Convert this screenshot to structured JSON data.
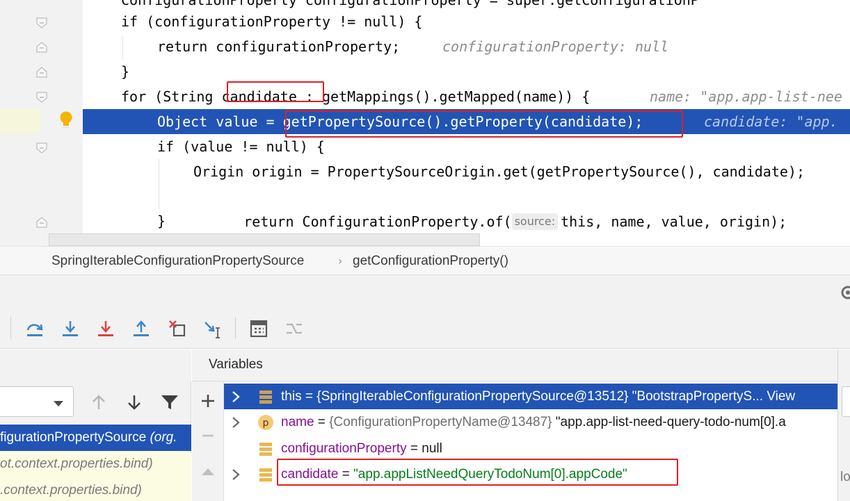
{
  "editor": {
    "lines": [
      {
        "code": "if (configurationProperty != null) {"
      },
      {
        "code": "return configurationProperty;",
        "hint": "configurationProperty: null"
      },
      {
        "code": "}"
      },
      {
        "code": "for (String candidate : getMappings().getMapped(name)) {",
        "hint": "name: \"app.app-list-nee"
      },
      {
        "code": "Object value = getPropertySource().getProperty(candidate);",
        "hint": "candidate: \"app."
      },
      {
        "code": "if (value != null) {"
      },
      {
        "code": "Origin origin = PropertySourceOrigin.get(getPropertySource(), candidate);"
      },
      {
        "code_pre": "return ConfigurationProperty.of(",
        "param_hint": "source:",
        "code_post": "this, name, value, origin);"
      },
      {
        "code": "}"
      }
    ]
  },
  "breadcrumb": {
    "class_name": "SpringIterableConfigurationPropertySource",
    "method_name": "getConfigurationProperty()"
  },
  "debug": {
    "toolbar": {
      "step_over": "step-over",
      "step_into": "step-into",
      "force_step_into": "force-step-into",
      "step_out": "step-out",
      "drop_frame": "drop-frame",
      "run_to_cursor": "run-to-cursor",
      "evaluate": "evaluate-expression",
      "trace": "trace-current-stream"
    },
    "frames": [
      {
        "label": "figurationPropertySource",
        "pkg": "(org."
      },
      {
        "label": "ot.context.properties.bind)"
      },
      {
        "label": ".context.properties.bind)"
      }
    ],
    "variables_title": "Variables",
    "variables": [
      {
        "name": "this",
        "eq": " = ",
        "value": "{SpringIterableConfigurationPropertySource@13512}",
        "extra": " \"BootstrapPropertyS... View"
      },
      {
        "name": "name",
        "eq": " = ",
        "value": "{ConfigurationPropertyName@13487}",
        "extra": " \"app.app-list-need-query-todo-num[0].a"
      },
      {
        "name": "configurationProperty",
        "eq": " = ",
        "value": "null"
      },
      {
        "name": "candidate",
        "eq": " = ",
        "value": "\"app.appListNeedQueryTodoNum[0].appCode\""
      }
    ],
    "right_truncated": "lo"
  },
  "colors": {
    "selection": "#2154b5",
    "keyword": "#0033b3",
    "string": "#067d17",
    "variable_name": "#871094",
    "annotation_box": "#e02020"
  }
}
